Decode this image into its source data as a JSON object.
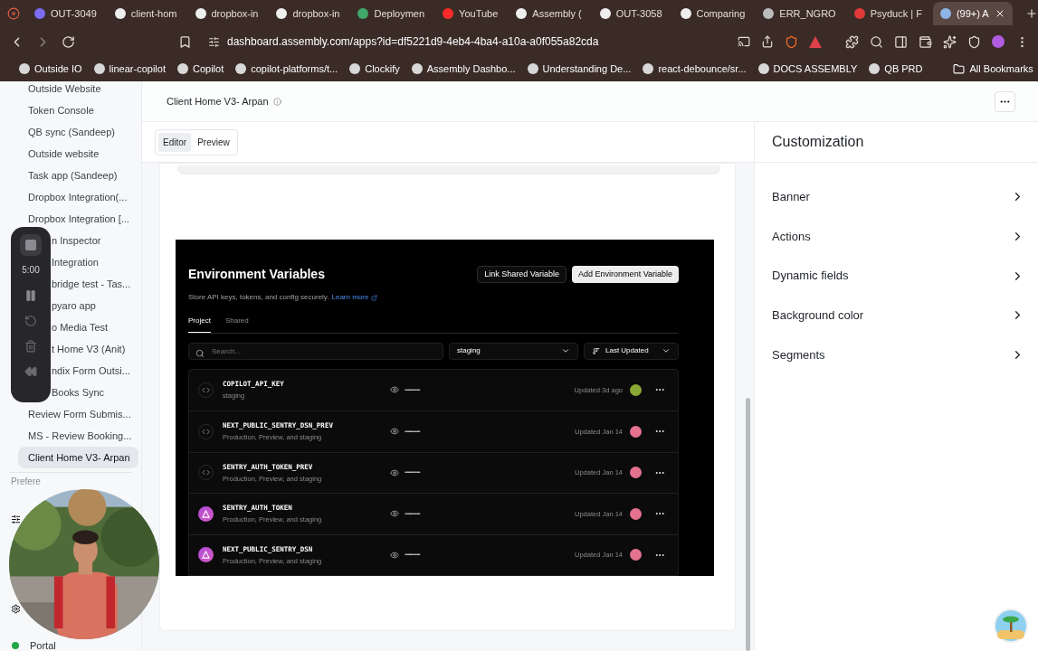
{
  "browser": {
    "tabs": [
      {
        "title": "OUT-3049",
        "selected": false
      },
      {
        "title": "client-hom",
        "selected": false
      },
      {
        "title": "dropbox-in",
        "selected": false
      },
      {
        "title": "dropbox-in",
        "selected": false
      },
      {
        "title": "Deploymen",
        "selected": false
      },
      {
        "title": "YouTube",
        "selected": false
      },
      {
        "title": "Assembly (",
        "selected": false
      },
      {
        "title": "OUT-3058",
        "selected": false
      },
      {
        "title": "Comparing",
        "selected": false
      },
      {
        "title": "ERR_NGRO",
        "selected": false
      },
      {
        "title": "Psyduck | F",
        "selected": false
      },
      {
        "title": "(99+) A",
        "selected": true
      }
    ],
    "url": "dashboard.assembly.com/apps?id=df5221d9-4eb4-4ba4-a10a-a0f055a82cda",
    "bookmarks": [
      "Outside IO",
      "linear-copilot",
      "Copilot",
      "copilot-platforms/t...",
      "Clockify",
      "Assembly Dashbo...",
      "Understanding De...",
      "react-debounce/sr...",
      "DOCS ASSEMBLY",
      "QB PRD"
    ],
    "all_bookmarks": "All Bookmarks"
  },
  "sidebar": {
    "items": [
      {
        "text": "Outside Website",
        "covered": false,
        "selected": false
      },
      {
        "text": "Token Console",
        "covered": false,
        "selected": false
      },
      {
        "text": "QB sync (Sandeep)",
        "covered": false,
        "selected": false
      },
      {
        "text": "Outside website",
        "covered": false,
        "selected": false
      },
      {
        "text": "Task app (Sandeep)",
        "covered": false,
        "selected": false
      },
      {
        "text": "Dropbox Integration(...",
        "covered": false,
        "selected": false
      },
      {
        "text": "Dropbox Integration [...",
        "covered": false,
        "selected": false
      },
      {
        "text": "n Inspector",
        "covered": true,
        "selected": false
      },
      {
        "text": "Integration",
        "covered": true,
        "selected": false
      },
      {
        "text": "bridge test - Tas...",
        "covered": true,
        "selected": false
      },
      {
        "text": "pyaro app",
        "covered": true,
        "selected": false
      },
      {
        "text": "o Media Test",
        "covered": true,
        "selected": false
      },
      {
        "text": "t Home V3 (Anit)",
        "covered": true,
        "selected": false
      },
      {
        "text": "ndix Form Outsi...",
        "covered": true,
        "selected": false
      },
      {
        "text": "Books Sync",
        "covered": true,
        "selected": false
      },
      {
        "text": "Review Form Submis...",
        "covered": false,
        "selected": false
      },
      {
        "text": "MS - Review Booking...",
        "covered": false,
        "selected": false
      },
      {
        "text": "Client Home V3- Arpan",
        "covered": false,
        "selected": true
      }
    ],
    "preferences": "Prefere",
    "portal": "Portal"
  },
  "recorder": {
    "time": "5:00"
  },
  "header": {
    "title": "Client Home V3- Arpan"
  },
  "view_toggle": [
    {
      "label": "Editor",
      "selected": true
    },
    {
      "label": "Preview",
      "selected": false
    }
  ],
  "embedded": {
    "title": "Environment Variables",
    "buttons": [
      {
        "label": "Link Shared Variable",
        "kind": "secondary"
      },
      {
        "label": "Add Environment Variable",
        "kind": "primary"
      }
    ],
    "description": "Store API keys, tokens, and config securely.",
    "link": "Learn more",
    "tabs": [
      {
        "label": "Project",
        "selected": true
      },
      {
        "label": "Shared",
        "selected": false
      }
    ],
    "search": {
      "placeholder": "Search..."
    },
    "environment": "staging",
    "sort": "Last Updated",
    "rows": [
      {
        "name": "COPILOT_API_KEY",
        "scope": "staging",
        "kind": "code",
        "value": "•••••••••••••••",
        "updated": "Updated 3d ago",
        "color": "#8aa836"
      },
      {
        "name": "NEXT_PUBLIC_SENTRY_DSN_PREV",
        "scope": "Production, Preview, and staging",
        "kind": "code",
        "value": "•••••••••••••••",
        "updated": "Updated Jan 14",
        "color": "#e4728f"
      },
      {
        "name": "SENTRY_AUTH_TOKEN_PREV",
        "scope": "Production, Preview, and staging",
        "kind": "code",
        "value": "•••••••••••••••",
        "updated": "Updated Jan 14",
        "color": "#e4728f"
      },
      {
        "name": "SENTRY_AUTH_TOKEN",
        "scope": "Production, Preview, and staging",
        "kind": "integration",
        "value": "•••••••••••••••",
        "updated": "Updated Jan 14",
        "color": "#e4728f"
      },
      {
        "name": "NEXT_PUBLIC_SENTRY_DSN",
        "scope": "Production, Preview, and staging",
        "kind": "integration",
        "value": "•••••••••••••••",
        "updated": "Updated Jan 14",
        "color": "#e4728f"
      }
    ]
  },
  "customization": {
    "title": "Customization",
    "sections": [
      "Banner",
      "Actions",
      "Dynamic fields",
      "Background color",
      "Segments"
    ]
  }
}
